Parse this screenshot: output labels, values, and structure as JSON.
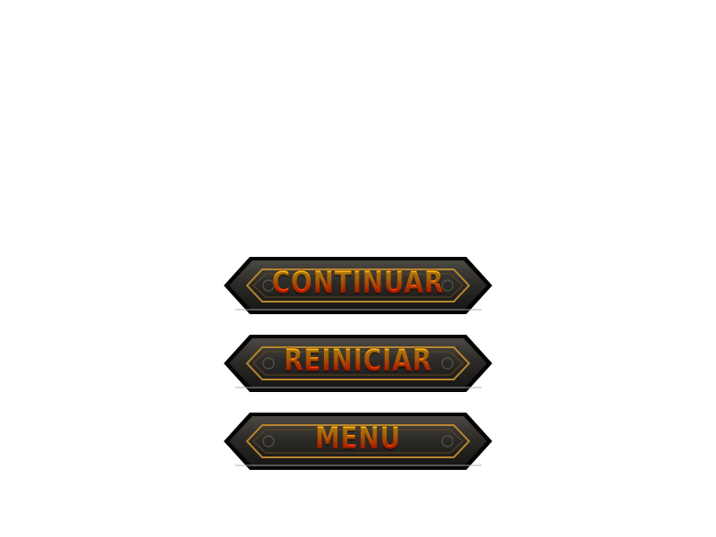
{
  "pause_menu": {
    "buttons": [
      {
        "label": "CONTINUAR"
      },
      {
        "label": "REINICIAR"
      },
      {
        "label": "MENU"
      }
    ]
  },
  "colors": {
    "background": "#ffffff",
    "button_frame": "#151412",
    "button_face": "#3a3833",
    "trim_gold": "#b9862d",
    "text_top": "#ffd21a",
    "text_bottom": "#d40000"
  }
}
